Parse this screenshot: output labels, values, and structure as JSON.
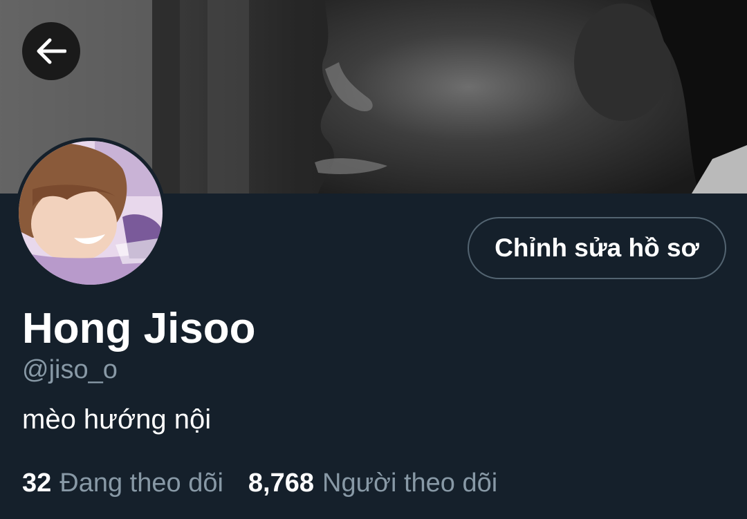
{
  "header": {
    "back_icon": "arrow-left-icon",
    "banner_description": ""
  },
  "profile": {
    "edit_button_label": "Chỉnh sửa hồ sơ",
    "display_name": "Hong Jisoo",
    "handle": "@jiso_o",
    "bio": "mèo hướng nội"
  },
  "stats": {
    "following_count": "32",
    "following_label": "Đang theo dõi",
    "followers_count": "8,768",
    "followers_label": "Người theo dõi"
  },
  "colors": {
    "background": "#15202b",
    "secondary_text": "#8899a6",
    "button_border": "#536471"
  }
}
